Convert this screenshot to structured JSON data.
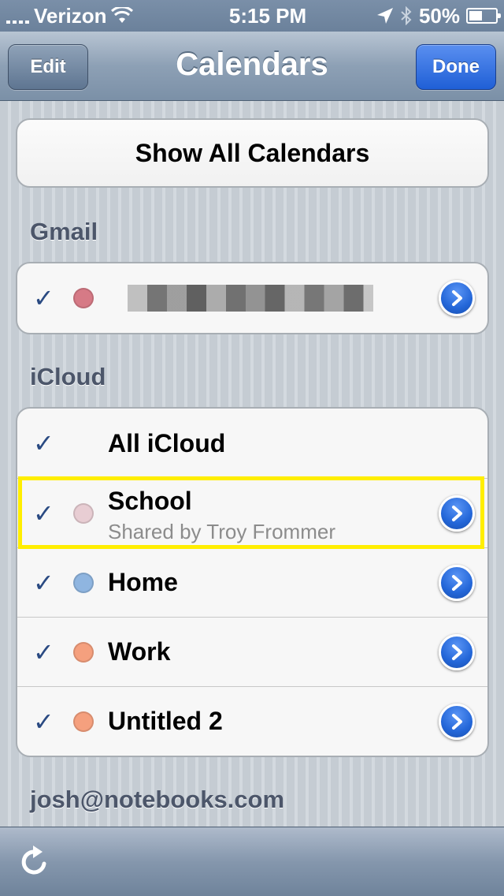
{
  "status_bar": {
    "carrier": "Verizon",
    "time": "5:15 PM",
    "battery": "50%",
    "battery_level": 0.5
  },
  "nav": {
    "title": "Calendars",
    "edit_label": "Edit",
    "done_label": "Done"
  },
  "show_all_label": "Show All Calendars",
  "sections": {
    "gmail": {
      "header": "Gmail",
      "color": "#d67a86"
    },
    "icloud": {
      "header": "iCloud",
      "all_label": "All iCloud",
      "items": [
        {
          "label": "School",
          "sub": "Shared by Troy Frommer",
          "color": "#e8cdd3"
        },
        {
          "label": "Home",
          "sub": "",
          "color": "#8fb5e0"
        },
        {
          "label": "Work",
          "sub": "",
          "color": "#f5a07e"
        },
        {
          "label": "Untitled 2",
          "sub": "",
          "color": "#f5a07e"
        }
      ]
    },
    "account": {
      "header": "josh@notebooks.com"
    }
  },
  "icons": {
    "check": "✓",
    "refresh": "refresh-icon",
    "disclosure": "chevron-right-icon",
    "wifi": "wifi-icon",
    "location": "location-arrow-icon",
    "bluetooth": "bluetooth-icon"
  },
  "colors": {
    "check": "#2a4a82",
    "highlight": "#ffee00",
    "done_button": "#2a6ae0"
  }
}
